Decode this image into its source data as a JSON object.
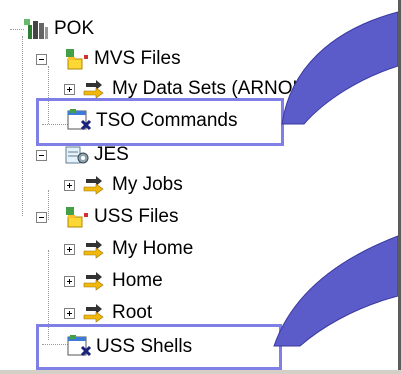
{
  "tree": {
    "root": {
      "label": "POK",
      "icon": "system-icon"
    },
    "items": [
      {
        "label": "MVS Files",
        "icon": "file-system-icon",
        "toggle": "minus"
      },
      {
        "label": "My Data Sets (ARNOLD.*)",
        "icon": "filter-arrow-icon",
        "toggle": "plus"
      },
      {
        "label": "TSO Commands",
        "icon": "command-icon",
        "toggle": "none"
      },
      {
        "label": "JES",
        "icon": "jobs-gear-icon",
        "toggle": "minus"
      },
      {
        "label": "My Jobs",
        "icon": "filter-arrow-icon",
        "toggle": "plus"
      },
      {
        "label": "USS Files",
        "icon": "file-system-icon",
        "toggle": "minus"
      },
      {
        "label": "My Home",
        "icon": "filter-arrow-icon",
        "toggle": "plus"
      },
      {
        "label": "Home",
        "icon": "filter-arrow-icon",
        "toggle": "plus"
      },
      {
        "label": "Root",
        "icon": "filter-arrow-icon",
        "toggle": "plus"
      },
      {
        "label": "USS Shells",
        "icon": "command-icon",
        "toggle": "none"
      }
    ]
  },
  "colors": {
    "highlight": "#7f7fe6",
    "arrow": "#5b5bc9",
    "arrow_edge": "#3a3aa0",
    "dots": "#9a9a9a"
  }
}
